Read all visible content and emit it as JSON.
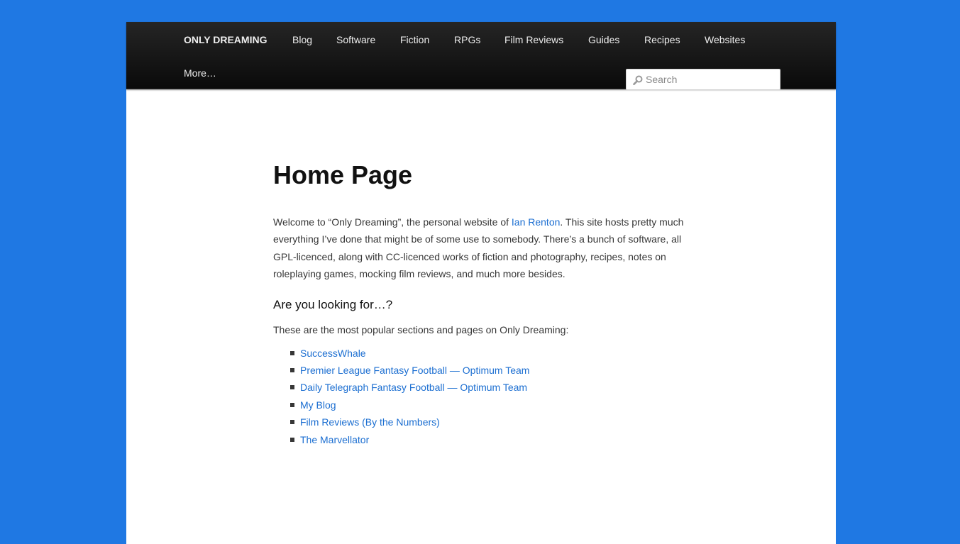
{
  "nav": {
    "brand": "ONLY DREAMING",
    "items": [
      {
        "label": "Blog"
      },
      {
        "label": "Software"
      },
      {
        "label": "Fiction"
      },
      {
        "label": "RPGs"
      },
      {
        "label": "Film Reviews"
      },
      {
        "label": "Guides"
      },
      {
        "label": "Recipes"
      },
      {
        "label": "Websites"
      },
      {
        "label": "More…"
      }
    ]
  },
  "search": {
    "placeholder": "Search",
    "icon": "search-icon"
  },
  "main": {
    "title": "Home Page",
    "intro": {
      "before": "Welcome to “Only Dreaming”, the personal website of ",
      "link": "Ian Renton",
      "after": ". This site hosts pretty much everything I’ve done that might be of some use to somebody. There’s a bunch of software, all GPL-licenced, along with CC-licenced works of fiction and photography, recipes, notes on roleplaying games, mocking film reviews, and much more besides."
    },
    "subheading": "Are you looking for…?",
    "lead": "These are the most popular sections and pages on Only Dreaming:",
    "links": [
      "SuccessWhale",
      "Premier League Fantasy Football — Optimum Team",
      "Daily Telegraph Fantasy Football — Optimum Team",
      "My Blog",
      "Film Reviews (By the Numbers)",
      "The Marvellator"
    ]
  },
  "colors": {
    "background": "#1f78e3",
    "nav": "#111111",
    "link": "#1b6ed1",
    "text": "#373737"
  }
}
